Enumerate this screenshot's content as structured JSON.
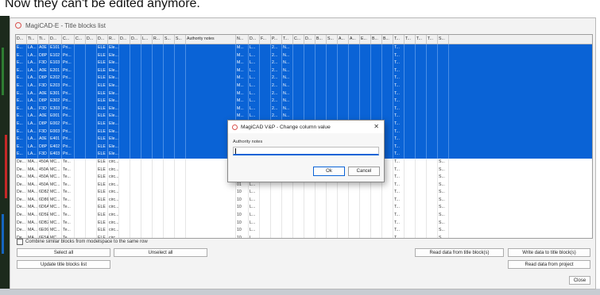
{
  "caption": "Now they can't be edited anymore.",
  "window": {
    "title": "MagiCAD-E - Title blocks list"
  },
  "columns": [
    "D...",
    "Ti...",
    "Ti...",
    "D...",
    "C...",
    "C...",
    "D...",
    "D...",
    "R...",
    "D...",
    "D...",
    "L...",
    "R...",
    "S...",
    "S...",
    "Authority notes",
    "N...",
    "D...",
    "F...",
    "P...",
    "T...",
    "C...",
    "D...",
    "B...",
    "S...",
    "A...",
    "A...",
    "E...",
    "B...",
    "B...",
    "T...",
    "T...",
    "T...",
    "T...",
    "S..."
  ],
  "rows": [
    {
      "sel": true,
      "c": [
        "E...",
        "LA...",
        "A0E",
        "E101",
        "Pri...",
        "",
        "",
        "ELE",
        "Ele...",
        "",
        "",
        "",
        "",
        "",
        "",
        "",
        "M...",
        "L...",
        "",
        "2...",
        "N...",
        "",
        "",
        "",
        "",
        "",
        "",
        "",
        "",
        "",
        "T...",
        "",
        "",
        "",
        ""
      ]
    },
    {
      "sel": true,
      "c": [
        "E...",
        "LA...",
        "D8P",
        "E102",
        "Pri...",
        "",
        "",
        "ELE",
        "Ele...",
        "",
        "",
        "",
        "",
        "",
        "",
        "",
        "M...",
        "L...",
        "",
        "2...",
        "N...",
        "",
        "",
        "",
        "",
        "",
        "",
        "",
        "",
        "",
        "T...",
        "",
        "",
        "",
        ""
      ]
    },
    {
      "sel": true,
      "c": [
        "E...",
        "LA...",
        "F3D",
        "E103",
        "Pri...",
        "",
        "",
        "ELE",
        "Ele...",
        "",
        "",
        "",
        "",
        "",
        "",
        "",
        "M...",
        "L...",
        "",
        "2...",
        "N...",
        "",
        "",
        "",
        "",
        "",
        "",
        "",
        "",
        "",
        "T...",
        "",
        "",
        "",
        ""
      ]
    },
    {
      "sel": true,
      "c": [
        "E...",
        "LA...",
        "A0E",
        "E201",
        "Pri...",
        "",
        "",
        "ELE",
        "Ele...",
        "",
        "",
        "",
        "",
        "",
        "",
        "",
        "M...",
        "L...",
        "",
        "2...",
        "N...",
        "",
        "",
        "",
        "",
        "",
        "",
        "",
        "",
        "",
        "T...",
        "",
        "",
        "",
        ""
      ]
    },
    {
      "sel": true,
      "c": [
        "E...",
        "LA...",
        "D8P",
        "E202",
        "Pri...",
        "",
        "",
        "ELE",
        "Ele...",
        "",
        "",
        "",
        "",
        "",
        "",
        "",
        "M...",
        "L...",
        "",
        "2...",
        "N...",
        "",
        "",
        "",
        "",
        "",
        "",
        "",
        "",
        "",
        "T...",
        "",
        "",
        "",
        ""
      ]
    },
    {
      "sel": true,
      "c": [
        "E...",
        "LA...",
        "F3D",
        "E203",
        "Pri...",
        "",
        "",
        "ELE",
        "Ele...",
        "",
        "",
        "",
        "",
        "",
        "",
        "",
        "M...",
        "L...",
        "",
        "2...",
        "N...",
        "",
        "",
        "",
        "",
        "",
        "",
        "",
        "",
        "",
        "T...",
        "",
        "",
        "",
        ""
      ]
    },
    {
      "sel": true,
      "c": [
        "E...",
        "LA...",
        "A0E",
        "E301",
        "Pri...",
        "",
        "",
        "ELE",
        "Ele...",
        "",
        "",
        "",
        "",
        "",
        "",
        "",
        "M...",
        "L...",
        "",
        "2...",
        "N...",
        "",
        "",
        "",
        "",
        "",
        "",
        "",
        "",
        "",
        "T...",
        "",
        "",
        "",
        ""
      ]
    },
    {
      "sel": true,
      "c": [
        "E...",
        "LA...",
        "D8P",
        "E302",
        "Pri...",
        "",
        "",
        "ELE",
        "Ele...",
        "",
        "",
        "",
        "",
        "",
        "",
        "",
        "M...",
        "L...",
        "",
        "2...",
        "N...",
        "",
        "",
        "",
        "",
        "",
        "",
        "",
        "",
        "",
        "T...",
        "",
        "",
        "",
        ""
      ]
    },
    {
      "sel": true,
      "c": [
        "E...",
        "LA...",
        "F3D",
        "E303",
        "Pri...",
        "",
        "",
        "ELE",
        "Ele...",
        "",
        "",
        "",
        "",
        "",
        "",
        "",
        "M...",
        "L...",
        "",
        "2...",
        "N...",
        "",
        "",
        "",
        "",
        "",
        "",
        "",
        "",
        "",
        "T...",
        "",
        "",
        "",
        ""
      ]
    },
    {
      "sel": true,
      "c": [
        "E...",
        "LA...",
        "A0E",
        "E001",
        "Pri...",
        "",
        "",
        "ELE",
        "Ele...",
        "",
        "",
        "",
        "",
        "",
        "",
        "",
        "M...",
        "L...",
        "",
        "2...",
        "N...",
        "",
        "",
        "",
        "",
        "",
        "",
        "",
        "",
        "",
        "T...",
        "",
        "",
        "",
        ""
      ]
    },
    {
      "sel": true,
      "c": [
        "E...",
        "LA...",
        "D8P",
        "E002",
        "Pri...",
        "",
        "",
        "ELE",
        "Ele...",
        "",
        "",
        "",
        "",
        "",
        "",
        "",
        "M...",
        "L...",
        "",
        "2...",
        "N...",
        "",
        "",
        "",
        "",
        "",
        "",
        "",
        "",
        "",
        "T...",
        "",
        "",
        "",
        ""
      ]
    },
    {
      "sel": true,
      "c": [
        "E...",
        "LA...",
        "F3D",
        "E003",
        "Pri...",
        "",
        "",
        "ELE",
        "Ele...",
        "",
        "",
        "",
        "",
        "",
        "",
        "",
        "M...",
        "L...",
        "",
        "2...",
        "N...",
        "",
        "",
        "",
        "",
        "",
        "",
        "",
        "",
        "",
        "T...",
        "",
        "",
        "",
        ""
      ]
    },
    {
      "sel": true,
      "c": [
        "E...",
        "LA...",
        "A0E",
        "E401",
        "Pri...",
        "",
        "",
        "ELE",
        "Ele...",
        "",
        "",
        "",
        "",
        "",
        "",
        "",
        "M...",
        "L...",
        "",
        "2...",
        "N...",
        "",
        "",
        "",
        "",
        "",
        "",
        "",
        "",
        "",
        "T...",
        "",
        "",
        "",
        ""
      ]
    },
    {
      "sel": true,
      "c": [
        "E...",
        "LA...",
        "D8P",
        "E402",
        "Pri...",
        "",
        "",
        "ELE",
        "Ele...",
        "",
        "",
        "",
        "",
        "",
        "",
        "",
        "M...",
        "L...",
        "",
        "2...",
        "N...",
        "",
        "",
        "",
        "",
        "",
        "",
        "",
        "",
        "",
        "T...",
        "",
        "",
        "",
        ""
      ]
    },
    {
      "sel": true,
      "c": [
        "E...",
        "LA...",
        "F3D",
        "E403",
        "Pri...",
        "",
        "",
        "ELE",
        "Ele...",
        "",
        "",
        "",
        "",
        "",
        "",
        "",
        "M...",
        "L...",
        "",
        "2...",
        "N...",
        "",
        "",
        "",
        "",
        "",
        "",
        "",
        "",
        "",
        "T...",
        "",
        "",
        "",
        ""
      ]
    },
    {
      "sel": false,
      "c": [
        "De...",
        "MA...",
        "450A",
        "MC...",
        "Te...",
        "",
        "",
        "ELE",
        "circ...",
        "",
        "",
        "",
        "",
        "",
        "",
        "",
        "",
        "",
        "",
        "",
        "",
        "",
        "",
        "",
        "",
        "",
        "",
        "",
        "",
        "",
        "T...",
        "",
        "",
        "",
        "S..."
      ]
    },
    {
      "sel": false,
      "c": [
        "De...",
        "MA...",
        "450A",
        "MC...",
        "Te...",
        "",
        "",
        "ELE",
        "circ...",
        "",
        "",
        "",
        "",
        "",
        "",
        "",
        "",
        "",
        "",
        "",
        "",
        "",
        "",
        "",
        "",
        "",
        "",
        "",
        "",
        "",
        "T...",
        "",
        "",
        "",
        "S..."
      ]
    },
    {
      "sel": false,
      "c": [
        "De...",
        "MA...",
        "450A",
        "MC...",
        "Te...",
        "",
        "",
        "ELE",
        "circ...",
        "",
        "",
        "",
        "",
        "",
        "",
        "",
        "",
        "",
        "",
        "",
        "",
        "",
        "",
        "",
        "",
        "",
        "",
        "",
        "",
        "",
        "T...",
        "",
        "",
        "",
        "S..."
      ]
    },
    {
      "sel": false,
      "c": [
        "De...",
        "MA...",
        "450A",
        "MC...",
        "Te...",
        "",
        "",
        "ELE",
        "circ...",
        "",
        "",
        "",
        "",
        "",
        "",
        "",
        "01",
        "L...",
        "",
        "",
        "",
        "",
        "",
        "",
        "",
        "",
        "",
        "",
        "",
        "",
        "T...",
        "",
        "",
        "",
        "S..."
      ]
    },
    {
      "sel": false,
      "c": [
        "De...",
        "MA...",
        "6D8Z",
        "MC...",
        "Te...",
        "",
        "",
        "ELE",
        "circ...",
        "",
        "",
        "",
        "",
        "",
        "",
        "",
        "10",
        "L...",
        "",
        "",
        "",
        "",
        "",
        "",
        "",
        "",
        "",
        "",
        "",
        "",
        "T...",
        "",
        "",
        "",
        "S..."
      ]
    },
    {
      "sel": false,
      "c": [
        "De...",
        "MA...",
        "6D86",
        "MC...",
        "Te...",
        "",
        "",
        "ELE",
        "circ...",
        "",
        "",
        "",
        "",
        "",
        "",
        "",
        "10",
        "L...",
        "",
        "",
        "",
        "",
        "",
        "",
        "",
        "",
        "",
        "",
        "",
        "",
        "T...",
        "",
        "",
        "",
        "S..."
      ]
    },
    {
      "sel": false,
      "c": [
        "De...",
        "MA...",
        "6D6A",
        "MC...",
        "Te...",
        "",
        "",
        "ELE",
        "circ...",
        "",
        "",
        "",
        "",
        "",
        "",
        "",
        "10",
        "L...",
        "",
        "",
        "",
        "",
        "",
        "",
        "",
        "",
        "",
        "",
        "",
        "",
        "T...",
        "",
        "",
        "",
        "S..."
      ]
    },
    {
      "sel": false,
      "c": [
        "De...",
        "MA...",
        "6D5E",
        "MC...",
        "Te...",
        "",
        "",
        "ELE",
        "circ...",
        "",
        "",
        "",
        "",
        "",
        "",
        "",
        "10",
        "L...",
        "",
        "",
        "",
        "",
        "",
        "",
        "",
        "",
        "",
        "",
        "",
        "",
        "T...",
        "",
        "",
        "",
        "S..."
      ]
    },
    {
      "sel": false,
      "c": [
        "De...",
        "MA...",
        "6DB2",
        "MC...",
        "Te...",
        "",
        "",
        "ELE",
        "circ...",
        "",
        "",
        "",
        "",
        "",
        "",
        "",
        "10",
        "L...",
        "",
        "",
        "",
        "",
        "",
        "",
        "",
        "",
        "",
        "",
        "",
        "",
        "T...",
        "",
        "",
        "",
        "S..."
      ]
    },
    {
      "sel": false,
      "c": [
        "De...",
        "MA...",
        "6E06",
        "MC...",
        "Te...",
        "",
        "",
        "ELE",
        "circ...",
        "",
        "",
        "",
        "",
        "",
        "",
        "",
        "10",
        "L...",
        "",
        "",
        "",
        "",
        "",
        "",
        "",
        "",
        "",
        "",
        "",
        "",
        "T...",
        "",
        "",
        "",
        "S..."
      ]
    },
    {
      "sel": false,
      "c": [
        "De...",
        "MA...",
        "6E5A",
        "MC...",
        "Te...",
        "",
        "",
        "ELE",
        "circ...",
        "",
        "",
        "",
        "",
        "",
        "",
        "",
        "10",
        "L...",
        "",
        "",
        "",
        "",
        "",
        "",
        "",
        "",
        "",
        "",
        "",
        "",
        "T...",
        "",
        "",
        "",
        "S..."
      ]
    }
  ],
  "options": {
    "combine_label": "Combine similar blocks from modelspace to the same row",
    "combine_checked": false
  },
  "buttons": {
    "select_all": "Select all",
    "unselect_all": "Unselect all",
    "update_list": "Update title blocks list",
    "read_from_block": "Read data from title block(s)",
    "write_to_block": "Write data to title block(s)",
    "read_from_project": "Read data from project",
    "close": "Close"
  },
  "dialog": {
    "title": "MagiCAD V&P - Change column value",
    "field_label": "Authority notes",
    "field_value": "",
    "ok": "Ok",
    "cancel": "Cancel"
  },
  "colors": {
    "selection": "#0a63d6",
    "icon_red": "#d9534f"
  }
}
